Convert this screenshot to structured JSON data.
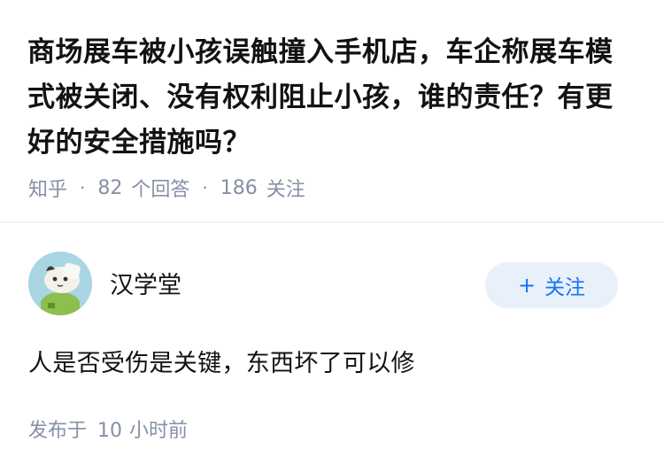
{
  "question": {
    "title": "商场展车被小孩误触撞入手机店，车企称展车模式被关闭、没有权利阻止小孩，谁的责任？有更好的安全措施吗？",
    "source": "知乎",
    "answer_count": "82",
    "answer_label": "个回答",
    "follower_count": "186",
    "follower_label": "关注"
  },
  "answer": {
    "author_name": "汉学堂",
    "follow_button_label": "关注",
    "follow_button_icon": "+",
    "content": "人是否受伤是关键，东西坏了可以修",
    "published_label": "发布于",
    "published_num": "10",
    "published_unit": "小时前"
  },
  "colors": {
    "accent": "#1772f6",
    "follow_bg": "#e8f0fa",
    "meta_gray": "#8590a6",
    "text": "#121212"
  }
}
